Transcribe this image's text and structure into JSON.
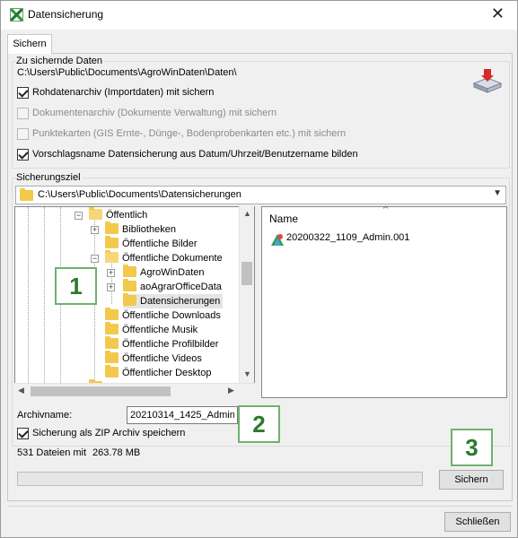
{
  "window": {
    "title": "Datensicherung"
  },
  "tabs": [
    {
      "label": "Sichern"
    }
  ],
  "source_group": {
    "label": "Zu sichernde Daten",
    "path": "C:\\Users\\Public\\Documents\\AgroWinDaten\\Daten\\",
    "options": [
      {
        "label": "Rohdatenarchiv (Importdaten) mit sichern",
        "checked": true,
        "enabled": true
      },
      {
        "label": "Dokumentenarchiv (Dokumente Verwaltung) mit sichern",
        "checked": false,
        "enabled": false
      },
      {
        "label": "Punktekarten (GIS Ernte-, Dünge-, Bodenprobenkarten etc.) mit sichern",
        "checked": false,
        "enabled": false
      },
      {
        "label": "Vorschlagsname Datensicherung aus Datum/Uhrzeit/Benutzername bilden",
        "checked": true,
        "enabled": true
      }
    ]
  },
  "target_group": {
    "label": "Sicherungsziel",
    "combo_value": "C:\\Users\\Public\\Documents\\Datensicherungen"
  },
  "tree": {
    "items": [
      {
        "label": "Öffentlich"
      },
      {
        "label": "Bibliotheken"
      },
      {
        "label": "Öffentliche Bilder"
      },
      {
        "label": "Öffentliche Dokumente"
      },
      {
        "label": "AgroWinDaten"
      },
      {
        "label": "aoAgrarOfficeData"
      },
      {
        "label": "Datensicherungen"
      },
      {
        "label": "Öffentliche Downloads"
      },
      {
        "label": "Öffentliche Musik"
      },
      {
        "label": "Öffentliche Profilbilder"
      },
      {
        "label": "Öffentliche Videos"
      },
      {
        "label": "Öffentlicher Desktop"
      }
    ]
  },
  "file_list": {
    "column_header": "Name",
    "files": [
      {
        "name": "20200322_1109_Admin.001"
      }
    ]
  },
  "archive": {
    "label": "Archivname:",
    "value": "20210314_1425_Admin",
    "zip_label": "Sicherung als ZIP Archiv speichern",
    "zip_checked": true
  },
  "status": {
    "file_count_text": "531 Dateien mit",
    "size_text": "263.78 MB",
    "progress": 0
  },
  "buttons": {
    "backup": "Sichern",
    "close": "Schließen"
  },
  "annotations": {
    "n1": "1",
    "n2": "2",
    "n3": "3"
  },
  "colors": {
    "badge_border": "#6fb16f",
    "badge_text": "#2a7a2a",
    "folder": "#f2c94c"
  }
}
